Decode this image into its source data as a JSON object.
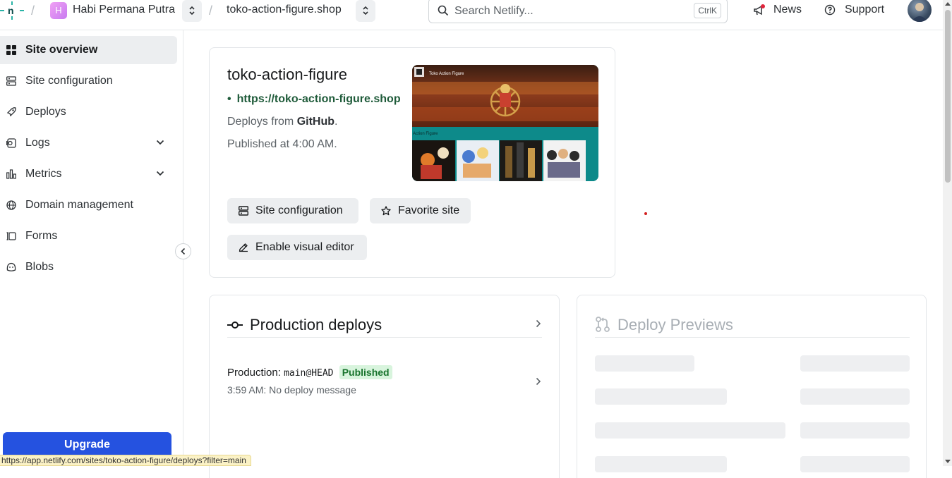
{
  "topbar": {
    "team_initial": "H",
    "team_name": "Habi Permana Putra",
    "site_name": "toko-action-figure.shop",
    "search_placeholder": "Search Netlify...",
    "search_shortcut": "CtrlK",
    "news_label": "News",
    "support_label": "Support"
  },
  "sidebar": {
    "items": [
      {
        "label": "Site overview",
        "icon": "grid-icon",
        "active": true
      },
      {
        "label": "Site configuration",
        "icon": "settings-icon"
      },
      {
        "label": "Deploys",
        "icon": "rocket-icon"
      },
      {
        "label": "Logs",
        "icon": "logs-icon",
        "expandable": true
      },
      {
        "label": "Metrics",
        "icon": "bar-chart-icon",
        "expandable": true
      },
      {
        "label": "Domain management",
        "icon": "globe-icon"
      },
      {
        "label": "Forms",
        "icon": "forms-icon"
      },
      {
        "label": "Blobs",
        "icon": "blobs-icon"
      }
    ],
    "upgrade_label": "Upgrade"
  },
  "site_card": {
    "title": "toko-action-figure",
    "url": "https://toko-action-figure.shop",
    "deploys_from_prefix": "Deploys from ",
    "deploys_from_provider": "GitHub",
    "deploys_from_suffix": ".",
    "published": "Published at 4:00 AM.",
    "preview_site_title": "Toko Action Figure",
    "preview_section_label": "Action Figure",
    "buttons": {
      "site_configuration": "Site configuration",
      "favorite_site": "Favorite site",
      "enable_visual_editor": "Enable visual editor"
    }
  },
  "production_deploys": {
    "title": "Production deploys",
    "deploy_label": "Production:",
    "branch_ref": "main@HEAD",
    "status": "Published",
    "subtitle": "3:59 AM: No deploy message"
  },
  "deploy_previews": {
    "title": "Deploy Previews"
  },
  "status_bar_url": "https://app.netlify.com/sites/toko-action-figure/deploys?filter=main",
  "colors": {
    "accent": "#2552e0",
    "published_badge_bg": "#d8f4dd",
    "published_badge_text": "#18742d",
    "link_green": "#1f5b3a"
  }
}
